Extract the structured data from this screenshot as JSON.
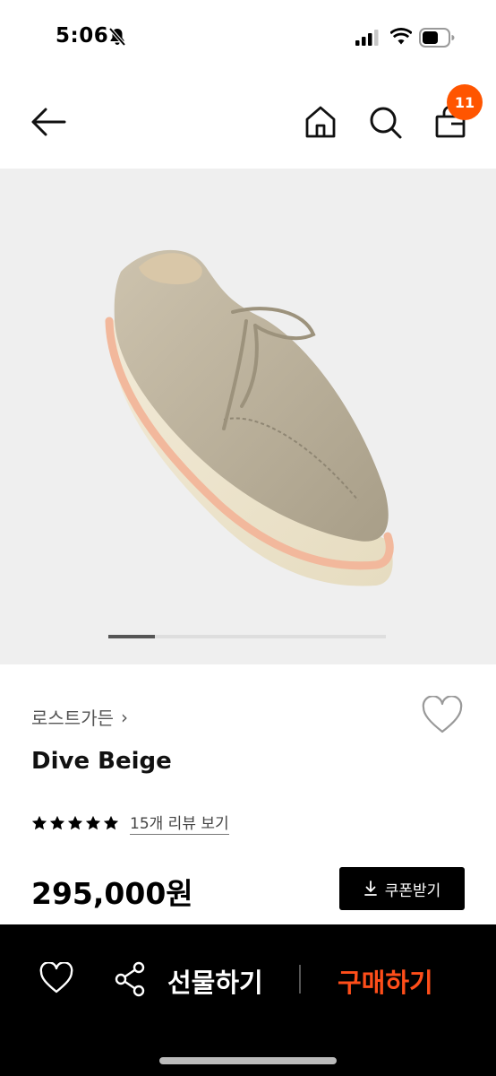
{
  "status_bar": {
    "time": "5:06",
    "icons": [
      "bell-muted-icon",
      "signal-icon",
      "wifi-icon",
      "battery-icon"
    ]
  },
  "nav": {
    "icons": [
      "back-arrow-icon",
      "home-icon",
      "search-icon",
      "shopping-bag-icon"
    ],
    "cart_count": "11"
  },
  "gallery": {
    "image": "beige suede moccasin shoe",
    "current_slide": 1,
    "total_slides": 6
  },
  "product": {
    "brand": "로스트가든",
    "brand_chevron": "›",
    "name": "Dive Beige",
    "rating_stars": 5,
    "review_link": "15개 리뷰 보기",
    "price": "295,000원",
    "coupon_button": "쿠폰받기"
  },
  "bottom_bar": {
    "gift_label": "선물하기",
    "buy_label": "구매하기"
  },
  "colors": {
    "accent": "#ff5500",
    "buy_text": "#ff4e1a",
    "hero_bg": "#efefef",
    "bottom_bar_bg": "#000000"
  }
}
